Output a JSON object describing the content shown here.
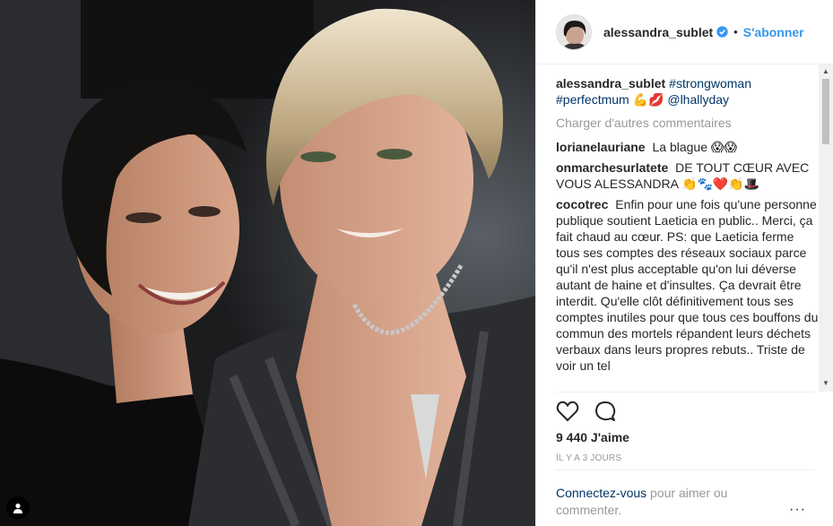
{
  "post": {
    "username": "alessandra_sublet",
    "follow_label": "S'abonner",
    "dot": "•",
    "caption_author": "alessandra_sublet",
    "caption_tags": "#strongwoman #perfectmum",
    "caption_emoji": "💪💋",
    "caption_mention": "@lhallyday",
    "load_more": "Charger d'autres commentaires",
    "likes": "9 440 J'aime",
    "time": "IL Y A 3 JOURS",
    "login_link": "Connectez-vous",
    "login_text": " pour aimer ou commenter.",
    "more_options": "···"
  },
  "comments": [
    {
      "author": "lorianelauriane",
      "text": "La blague 😱😱"
    },
    {
      "author": "onmarchesurlatete",
      "text": "DE TOUT CŒUR AVEC VOUS ALESSANDRA 👏🐾❤️👏🎩"
    },
    {
      "author": "cocotrec",
      "text": "Enfin pour une fois qu'une personne publique soutient Laeticia en public.. Merci, ça fait chaud au cœur. PS: que Laeticia ferme tous ses comptes des réseaux sociaux parce qu'il n'est plus acceptable qu'on lui déverse autant de haine et d'insultes. Ça devrait être interdit. Qu'elle clôt définitivement tous ses comptes inutiles pour que tous ces bouffons du commun des mortels répandent leurs déchets verbaux dans leurs propres rebuts.. Triste de voir un tel"
    }
  ],
  "colors": {
    "accent": "#3897f0",
    "link": "#003569",
    "muted": "#999999",
    "verified": "#3897f0"
  },
  "icons": [
    "user-tag-icon",
    "verified-badge-icon",
    "heart-icon",
    "comment-icon"
  ]
}
